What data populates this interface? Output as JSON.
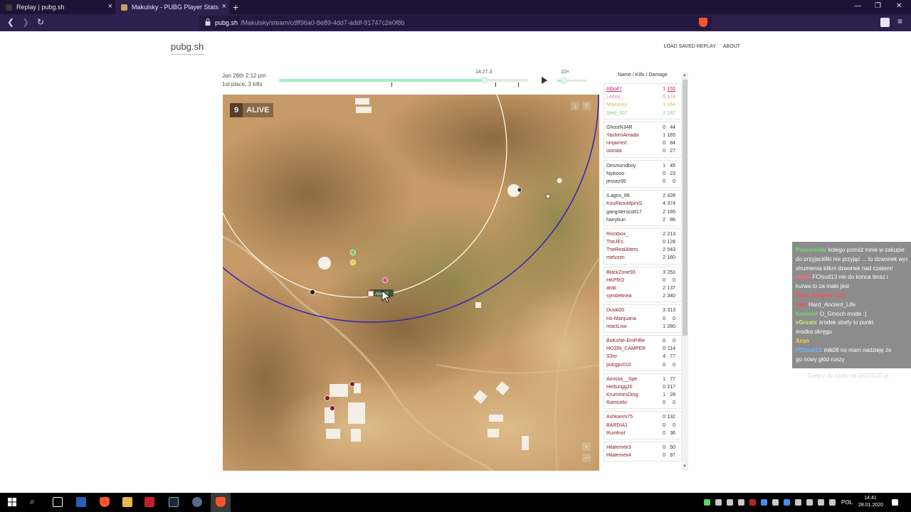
{
  "browser": {
    "tabs": [
      {
        "title": "Replay | pubg.sh",
        "active": false,
        "favicon_color": "#3a3a3a"
      },
      {
        "title": "Makulsky - PUBG Player Stats & Replays",
        "active": true,
        "favicon_color": "#c8a060"
      }
    ],
    "url_host": "pubg.sh",
    "url_path": "/Makulsky/steam/cdff96a0-8e89-4dd7-addf-91747c2e0f8b"
  },
  "site": {
    "logo": "pubg.sh",
    "links": [
      "LOAD SAVED REPLAY",
      "ABOUT"
    ]
  },
  "match": {
    "date": "Jan 28th 2:12 pm",
    "result": "1st place, 3 kills"
  },
  "timeline": {
    "time": "14:27.3",
    "progress": 0.826,
    "markers": [
      0.452,
      0.869,
      0.96
    ],
    "speed": "10×",
    "speed_level": 0.2
  },
  "map": {
    "alive_count": "9",
    "alive_label": "ALIVE",
    "player_label": "Albo47",
    "icons": [
      "download-icon",
      "help-icon",
      "zoom-in-icon",
      "zoom-out-icon"
    ]
  },
  "roster": {
    "header": "Name / Kills / Damage",
    "teams": [
      [
        {
          "name": "Albo47",
          "kills": "1",
          "damage": "155",
          "color": "#c0257a"
        },
        {
          "name": "Ledou_",
          "kills": "0",
          "damage": "174",
          "color": "#e87aa0"
        },
        {
          "name": "Makulsky",
          "kills": "1",
          "damage": "164",
          "color": "#c8c060"
        },
        {
          "name": "Seid_007",
          "kills": "2",
          "damage": "282",
          "color": "#7ed07e"
        }
      ],
      [
        {
          "name": "GhostN34R",
          "kills": "0",
          "damage": "44",
          "color": "#333333"
        },
        {
          "name": "YashiroAmada",
          "kills": "1",
          "damage": "165",
          "color": "#8a1a2a"
        },
        {
          "name": "ninjamert",
          "kills": "0",
          "damage": "84",
          "color": "#8a1a2a"
        },
        {
          "name": "oomda",
          "kills": "0",
          "damage": "27",
          "color": "#8a1a2a"
        }
      ],
      [
        {
          "name": "Desmondboy",
          "kills": "1",
          "damage": "45",
          "color": "#333333"
        },
        {
          "name": "Nyikooo",
          "kills": "0",
          "damage": "23",
          "color": "#333333"
        },
        {
          "name": "jessez95",
          "kills": "0",
          "damage": "0",
          "color": "#333333"
        }
      ],
      [
        {
          "name": "ILagos_88",
          "kills": "2",
          "damage": "428",
          "color": "#333333"
        },
        {
          "name": "KouRkouMpiniS",
          "kills": "4",
          "damage": "374",
          "color": "#8a1a2a"
        },
        {
          "name": "gangsterscott17",
          "kills": "2",
          "damage": "165",
          "color": "#333333"
        },
        {
          "name": "hairybun",
          "kills": "2",
          "damage": "86",
          "color": "#333333"
        }
      ],
      [
        {
          "name": "Rockbox_",
          "kills": "2",
          "damage": "213",
          "color": "#8a1a2a"
        },
        {
          "name": "TheJEs",
          "kills": "0",
          "damage": "128",
          "color": "#8a1a2a"
        },
        {
          "name": "TheRealAlters",
          "kills": "2",
          "damage": "543",
          "color": "#8a1a2a"
        },
        {
          "name": "melvzim",
          "kills": "2",
          "damage": "160",
          "color": "#8a1a2a"
        }
      ],
      [
        {
          "name": "BlackZone93",
          "kills": "3",
          "damage": "253",
          "color": "#8a1a2a"
        },
        {
          "name": "HKPRO",
          "kills": "0",
          "damage": "0",
          "color": "#8a1a2a"
        },
        {
          "name": "atob",
          "kills": "2",
          "damage": "137",
          "color": "#8a1a2a"
        },
        {
          "name": "symbelinea",
          "kills": "2",
          "damage": "340",
          "color": "#8a1a2a"
        }
      ],
      [
        {
          "name": "Duski00",
          "kills": "3",
          "damage": "313",
          "color": "#8a1a2a"
        },
        {
          "name": "Hz-Marijuana",
          "kills": "0",
          "damage": "0",
          "color": "#8a1a2a"
        },
        {
          "name": "reactLow",
          "kills": "1",
          "damage": "280",
          "color": "#8a1a2a"
        }
      ],
      [
        {
          "name": "BoKoNe-EmPiRe",
          "kills": "0",
          "damage": "0",
          "color": "#8a1a2a"
        },
        {
          "name": "HO3IN_CAMPER",
          "kills": "0",
          "damage": "114",
          "color": "#8a1a2a"
        },
        {
          "name": "S3ro",
          "kills": "4",
          "damage": "77",
          "color": "#8a1a2a"
        },
        {
          "name": "pubgpc010",
          "kills": "0",
          "damage": "0",
          "color": "#8a1a2a"
        }
      ],
      [
        {
          "name": "Amissa__Spe",
          "kills": "1",
          "damage": "77",
          "color": "#8a1a2a"
        },
        {
          "name": "Hellsingg20",
          "kills": "0",
          "damage": "217",
          "color": "#8a1a2a"
        },
        {
          "name": "KrummesDing",
          "kills": "1",
          "damage": "28",
          "color": "#8a1a2a"
        },
        {
          "name": "Ramcello",
          "kills": "0",
          "damage": "0",
          "color": "#8a1a2a"
        }
      ],
      [
        {
          "name": "Ashkanm75",
          "kills": "0",
          "damage": "132",
          "color": "#8a1a2a"
        },
        {
          "name": "BARDIA1",
          "kills": "0",
          "damage": "0",
          "color": "#8a1a2a"
        },
        {
          "name": "Rumfnof",
          "kills": "0",
          "damage": "36",
          "color": "#8a1a2a"
        }
      ],
      [
        {
          "name": "Hilalemek3",
          "kills": "0",
          "damage": "50",
          "color": "#8a1a2a"
        },
        {
          "name": "Hilalemek4",
          "kills": "0",
          "damage": "97",
          "color": "#8a1a2a"
        }
      ]
    ]
  },
  "chat": {
    "messages": [
      {
        "user": "Pancerniak",
        "text": "kolego pomóż mnie w zakupie",
        "color": "#7ad97a"
      },
      {
        "user": "",
        "text": "do przyjaciółki nie przyjąć ... to dzwonek wyszedł",
        "color": "#ffffff"
      },
      {
        "user": "",
        "text": "strumienia klikni dzwonek nad czatem!",
        "color": "#ffffff"
      },
      {
        "user": "eib88",
        "text": "FCloud13 nie do konca teraz i",
        "color": "#ff6b6b"
      },
      {
        "user": "",
        "text": "kurwa to za mało jest",
        "color": "#ffffff"
      },
      {
        "user": "Hard_Ancient_Life",
        "text": "",
        "color": "#ff4d4d"
      },
      {
        "user": "FaK",
        "text": "Hard_Ancient_Life",
        "color": "#ff4d4d"
      },
      {
        "user": "Kosiciel",
        "text": "O_Gmoch mode :)",
        "color": "#7ad97a"
      },
      {
        "user": "xGreatx",
        "text": "środek strefy to punkt",
        "color": "#c9f27a"
      },
      {
        "user": "",
        "text": "środka okręgu",
        "color": "#ffffff"
      },
      {
        "user": "Aron",
        "text": "",
        "color": "#ffd23f"
      },
      {
        "user": "FCloud13",
        "text": "mik08 no mam nadzieję że",
        "color": "#6ab7ff"
      },
      {
        "user": "",
        "text": "go nowy głód ruszy",
        "color": "#ffffff"
      }
    ],
    "footer": "Dołącz do czatu na JADISCO.pl"
  },
  "taskbar": {
    "language": "POL",
    "time": "14:41",
    "date": "28.01.2020"
  }
}
